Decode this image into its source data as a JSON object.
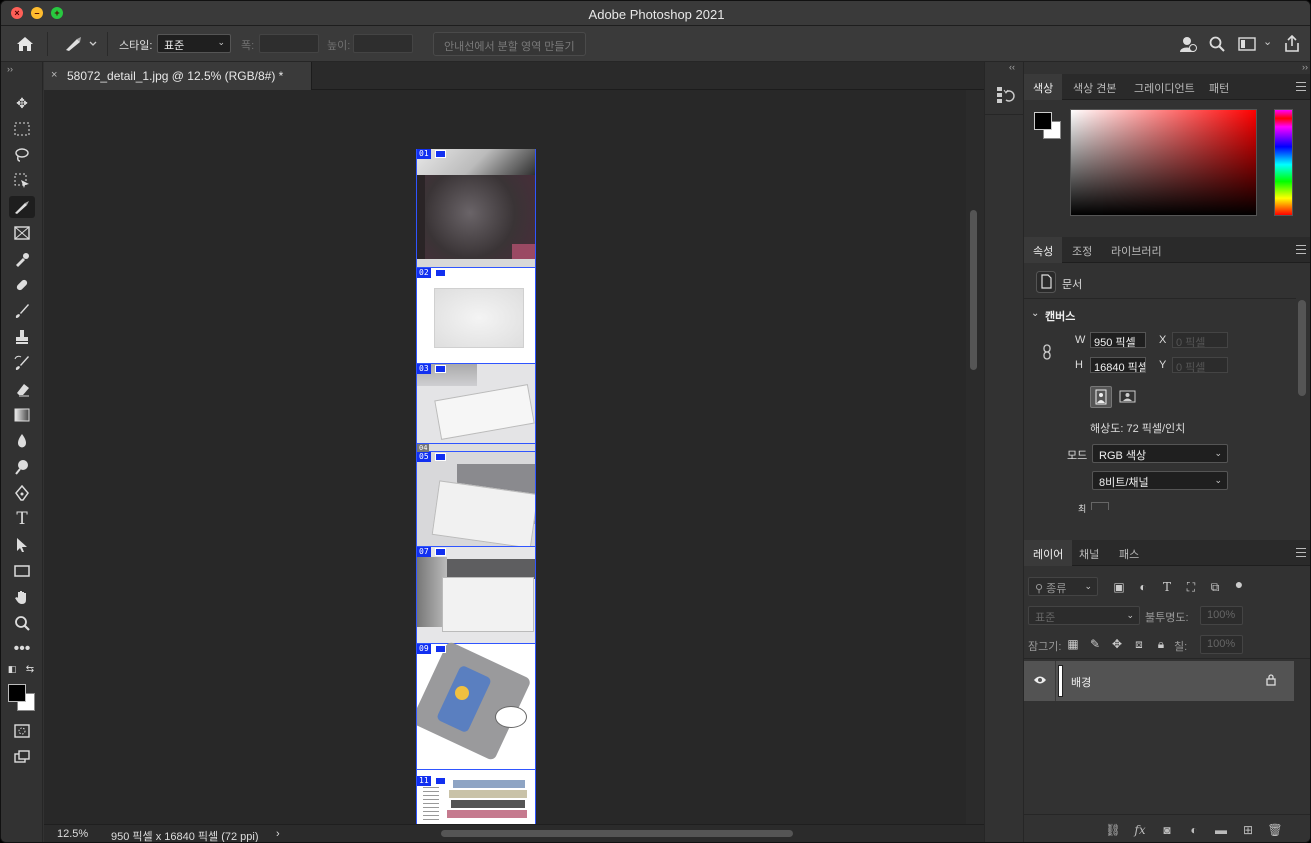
{
  "window": {
    "title": "Adobe Photoshop 2021"
  },
  "options_bar": {
    "style_label": "스타일:",
    "style_value": "표준",
    "width_label": "폭:",
    "height_label": "높이:",
    "guides_button": "안내선에서 분할 영역 만들기"
  },
  "document": {
    "tab_title": "58072_detail_1.jpg @ 12.5% (RGB/8#) *",
    "slice_tags": [
      "01",
      "02",
      "03",
      "04",
      "05",
      "07",
      "09",
      "11"
    ]
  },
  "status": {
    "zoom": "12.5%",
    "doc_info": "950 픽셀 x 16840 픽셀 (72 ppi)",
    "arrow": "›"
  },
  "color_panel": {
    "tabs": [
      "색상",
      "색상 견본",
      "그레이디언트",
      "패턴"
    ]
  },
  "properties_panel": {
    "tabs": [
      "속성",
      "조정",
      "라이브러리"
    ],
    "doc_label": "문서",
    "section": "캔버스",
    "w_label": "W",
    "w_value": "950 픽셀",
    "h_label": "H",
    "h_value": "16840 픽셀",
    "x_label": "X",
    "x_placeholder": "0 픽셀",
    "y_label": "Y",
    "y_placeholder": "0 픽셀",
    "resolution": "해상도: 72 픽셀/인치",
    "mode_label": "모드",
    "mode_value": "RGB 색상",
    "bit_value": "8비트/채널",
    "cut_label": "최"
  },
  "layers_panel": {
    "tabs": [
      "레이어",
      "채널",
      "패스"
    ],
    "filter_kind": "종류",
    "blend_mode": "표준",
    "opacity_label": "불투명도:",
    "opacity_value": "100%",
    "lock_label": "잠그기:",
    "fill_label": "칠:",
    "fill_value": "100%",
    "layer_name": "배경"
  }
}
